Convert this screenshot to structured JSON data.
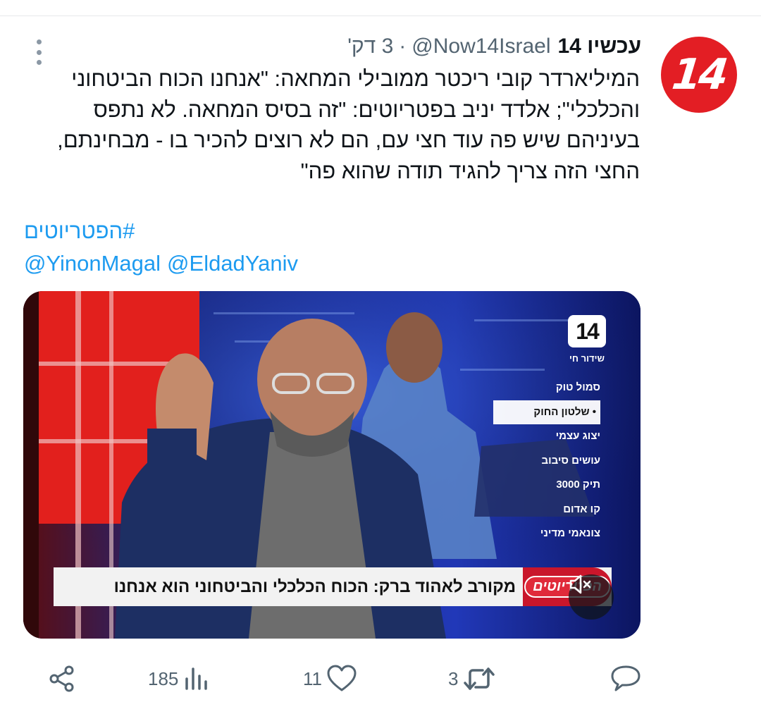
{
  "author": {
    "display_name": "עכשיו 14",
    "handle": "@Now14Israel",
    "separator": "·",
    "time": "3 דק'",
    "avatar_text": "14",
    "avatar_color": "#e31e24"
  },
  "tweet": {
    "lines": [
      "המיליארדר קובי ריכטר ממובילי המחאה: \"אנחנו הכוח הביטחוני",
      "והכלכלי\"; אלדד יניב בפטריוטים: \"זה בסיס המחאה. לא נתפס",
      "בעיניהם שיש פה עוד חצי עם, הם לא רוצים להכיר בו - מבחינתם,",
      "החצי הזה צריך להגיד תודה שהוא פה\""
    ],
    "hashtag": "#הפטריוטים",
    "mentions": [
      "@YinonMagal",
      "@EldadYaniv"
    ],
    "link_color": "#1d9bf0"
  },
  "video": {
    "channel_logo": "14",
    "live_label": "שידור חי",
    "shows": [
      {
        "label": "סמול טוק",
        "active": false
      },
      {
        "label": "• שלטון החוק",
        "active": true
      },
      {
        "label": "יצוג עצמי",
        "active": false
      },
      {
        "label": "עושים סיבוב",
        "active": false
      },
      {
        "label": "תיק 3000",
        "active": false
      },
      {
        "label": "קו אדום",
        "active": false
      },
      {
        "label": "צונאמי מדיני",
        "active": false
      }
    ],
    "ticker_brand": "הפטריוטים",
    "ticker_text": "מקורב לאהוד ברק: הכוח הכלכלי והביטחוני הוא אנחנו",
    "mute_icon": "speaker-muted-icon"
  },
  "actions": {
    "reply_count": "",
    "retweet_count": "3",
    "like_count": "11",
    "views_count": "185",
    "share_icon": "share-icon"
  }
}
